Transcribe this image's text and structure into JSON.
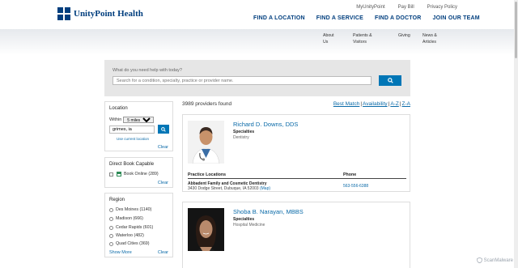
{
  "brand": {
    "name": "UnityPoint Health"
  },
  "utility_nav": [
    "MyUnityPoint",
    "Pay Bill",
    "Privacy Policy"
  ],
  "main_nav": [
    "FIND A LOCATION",
    "FIND A SERVICE",
    "FIND A DOCTOR",
    "JOIN OUR TEAM"
  ],
  "sub_nav": [
    {
      "line1": "About",
      "line2": "Us"
    },
    {
      "line1": "Patients &",
      "line2": "Visitors"
    },
    {
      "line1": "Giving",
      "line2": ""
    },
    {
      "line1": "News &",
      "line2": "Articles"
    }
  ],
  "search": {
    "label": "What do you need help with today?",
    "placeholder": "Search for a condition, specialty, practice or provider name.",
    "button_icon": "search-icon"
  },
  "location_filter": {
    "title": "Location",
    "within_label": "Within",
    "within_value": "5 miles",
    "location_value": "grimes, ia",
    "use_current": "Use current location",
    "clear": "Clear"
  },
  "direct_book": {
    "title": "Direct Book Capable",
    "option": "Book Online (289)",
    "clear": "Clear"
  },
  "region": {
    "title": "Region",
    "options": [
      "Des Moines (1140)",
      "Madison (666)",
      "Cedar Rapids (601)",
      "Waterloo (482)",
      "Quad Cities (369)"
    ],
    "show_more": "Show More",
    "clear": "Clear"
  },
  "results": {
    "count": "3989 providers found",
    "sort": [
      "Best Match",
      "Availability",
      "A-Z",
      "Z-A"
    ]
  },
  "providers": [
    {
      "name": "Richard D. Downs, DDS",
      "spec_label": "Specialties",
      "specialty": "Dentistry",
      "table_practice": "Practice Locations",
      "table_phone": "Phone",
      "practice": "Abbadent Family and Cosmetic Dentistry",
      "address": "3430 Dodge Street, Dubuque, IA 52003",
      "map": "(Map)",
      "phone": "563-556-6388"
    },
    {
      "name": "Shoba B. Narayan, MBBS",
      "spec_label": "Specialties",
      "specialty": "Hospital Medicine"
    }
  ],
  "watermark": "ScanMalware",
  "colors": {
    "brand": "#003e7e",
    "accent": "#0076b6",
    "link": "#0a6aa8"
  }
}
